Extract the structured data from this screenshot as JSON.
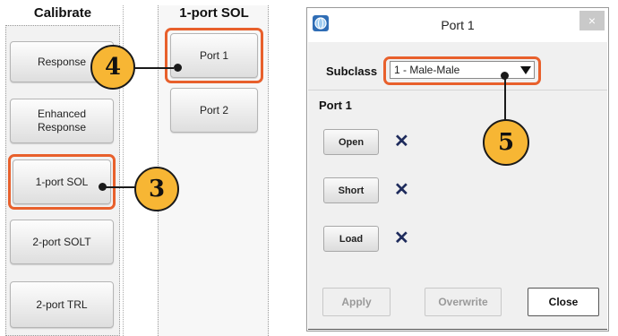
{
  "calibrate": {
    "title": "Calibrate",
    "buttons": [
      "Response",
      "Enhanced\nResponse",
      "1-port SOL",
      "2-port SOLT",
      "2-port TRL"
    ]
  },
  "sol_panel": {
    "title": "1-port SOL",
    "buttons": [
      "Port 1",
      "Port 2"
    ]
  },
  "dialog": {
    "title": "Port 1",
    "close_glyph": "×",
    "subclass_label": "Subclass",
    "subclass_value": "1 - Male-Male",
    "section_label": "Port 1",
    "standards": [
      {
        "label": "Open",
        "status": "✕"
      },
      {
        "label": "Short",
        "status": "✕"
      },
      {
        "label": "Load",
        "status": "✕"
      }
    ],
    "footer": {
      "apply": "Apply",
      "overwrite": "Overwrite",
      "close": "Close"
    }
  },
  "callouts": {
    "c3": "3",
    "c4": "4",
    "c5": "5"
  },
  "colors": {
    "highlight": "#e8602c",
    "callout_fill": "#f7b634",
    "x_mark": "#1e2b5c"
  }
}
